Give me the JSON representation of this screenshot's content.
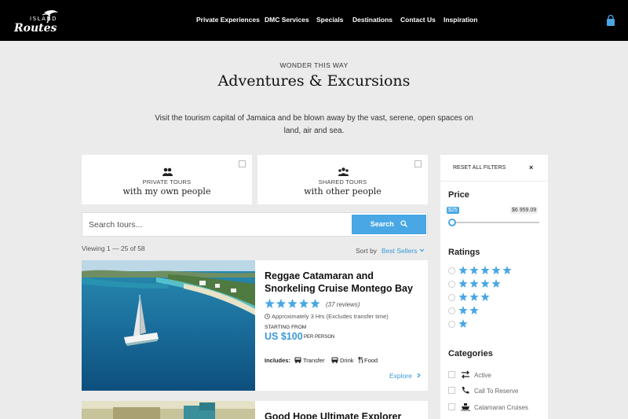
{
  "brand": {
    "logo_text": "ISLAND Routes"
  },
  "nav": {
    "items": [
      "Private Experiences",
      "DMC Services",
      "Specials",
      "Destinations",
      "Contact Us",
      "Inspiration"
    ]
  },
  "header": {
    "eyebrow": "WONDER THIS WAY",
    "title": "Adventures & Excursions",
    "intro": "Visit the tourism capital of Jamaica and be blown away by the vast, serene, open spaces on land, air and sea."
  },
  "tour_types": [
    {
      "sub": "PRIVATE TOURS",
      "main": "with my own people",
      "icon": "group-icon"
    },
    {
      "sub": "SHARED TOURS",
      "main": "with other people",
      "icon": "crowd-icon"
    }
  ],
  "search": {
    "placeholder": "Search tours...",
    "button": "Search"
  },
  "results": {
    "viewing": "Viewing  1 — 25 of 58",
    "sort_label": "Sort by",
    "sort_value": "Best Sellers"
  },
  "tours": [
    {
      "title": "Reggae Catamaran and Snorkeling Cruise Montego Bay",
      "rating": 5,
      "reviews": "(37 reviews)",
      "duration": "Approximately 3 Hrs (Excludes transfer time)",
      "starting": "STARTING FROM",
      "price": "US $100",
      "per": "PER PERSON",
      "includes_label": "Includes:",
      "includes": [
        "Transfer",
        "Drink",
        "Food"
      ],
      "explore": "Explore"
    },
    {
      "title": "Good Hope Ultimate Explorer"
    }
  ],
  "filters": {
    "reset": "RESET ALL FILTERS",
    "reset_icon": "×",
    "price_title": "Price",
    "price_min": "$25",
    "price_max": "$6 959.09",
    "price_level": 0,
    "ratings_title": "Ratings",
    "ratings": [
      5,
      4,
      3,
      2,
      1
    ],
    "categories_title": "Categories",
    "categories": [
      {
        "label": "Active",
        "icon": "arrows-icon"
      },
      {
        "label": "Call To Reserve",
        "icon": "phone-icon"
      },
      {
        "label": "Catamaran Cruises",
        "icon": "ship-icon"
      }
    ]
  },
  "colors": {
    "accent": "#49a7e5",
    "topbar": "#000000",
    "background": "#ebebeb"
  }
}
